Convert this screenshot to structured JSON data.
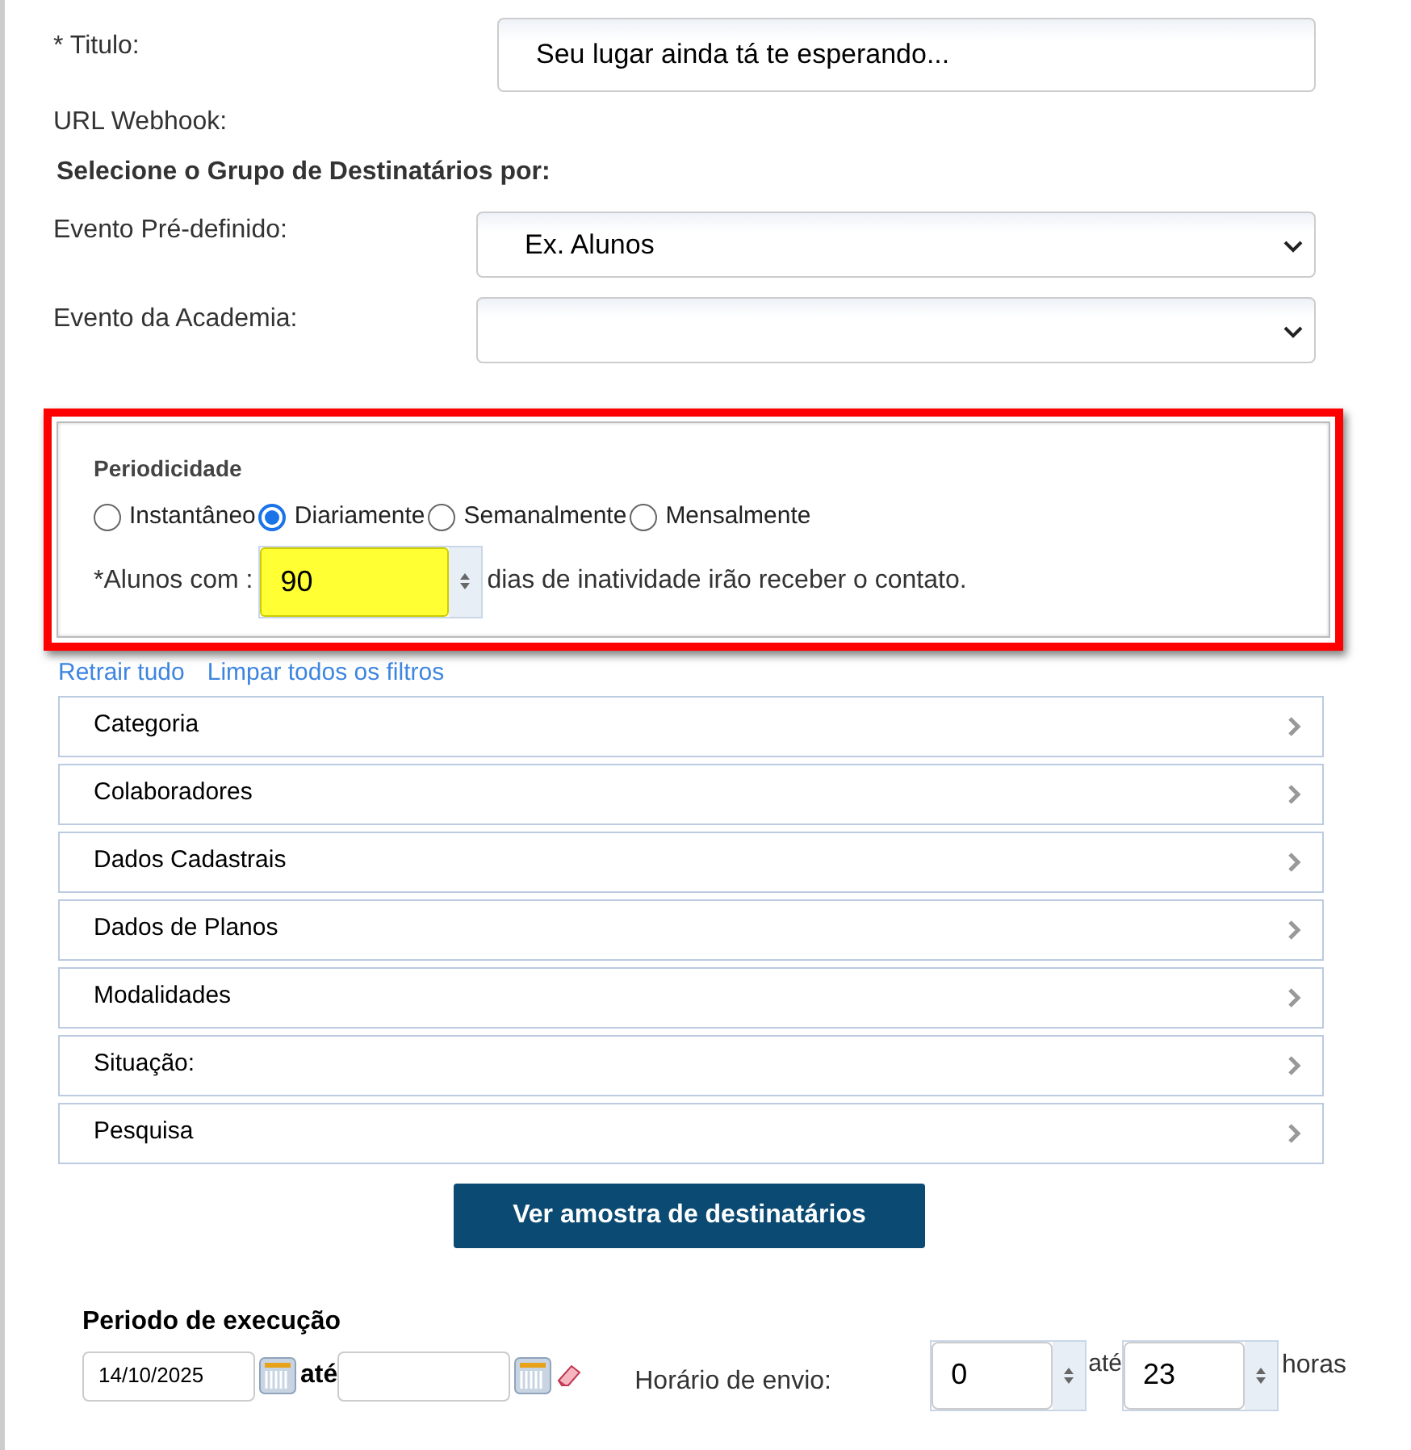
{
  "form": {
    "title_label": "* Titulo:",
    "title_value": "Seu lugar ainda tá te esperando...",
    "webhook_label": "URL Webhook:",
    "group_heading": "Selecione o Grupo de Destinatários por:",
    "selects": [
      {
        "label": "Evento Pré-definido:",
        "value": "Ex. Alunos"
      },
      {
        "label": "Evento da Academia:"
      }
    ]
  },
  "periodicidade": {
    "heading": "Periodicidade",
    "options": [
      {
        "label": "Instantâneo",
        "selected": false
      },
      {
        "label": "Diariamente",
        "selected": true
      },
      {
        "label": "Semanalmente",
        "selected": false
      },
      {
        "label": "Mensalmente",
        "selected": false
      }
    ],
    "prefix": "*Alunos com :",
    "days": "90",
    "suffix": "dias de inatividade irão receber o contato."
  },
  "links": [
    "Retrair tudo",
    "Limpar todos os filtros"
  ],
  "filters": [
    {
      "label": "Categoria",
      "expanded": false
    },
    {
      "label": "Colaboradores",
      "expanded": false
    },
    {
      "label": "Dados Cadastrais",
      "expanded": false
    },
    {
      "label": "Dados de Planos",
      "expanded": false
    },
    {
      "label": "Modalidades",
      "expanded": false
    },
    {
      "label": "Situação:",
      "expanded": false
    },
    {
      "label": "Pesquisa",
      "expanded": false
    }
  ],
  "preview_button": "Ver amostra de destinatários",
  "execucao": {
    "heading": "Periodo de execução",
    "start_date": "14/10/2025",
    "until": "até",
    "send_label": "Horário de envio:",
    "hour_from": "0",
    "hour_until": "até",
    "hour_to": "23",
    "hours": "horas"
  }
}
